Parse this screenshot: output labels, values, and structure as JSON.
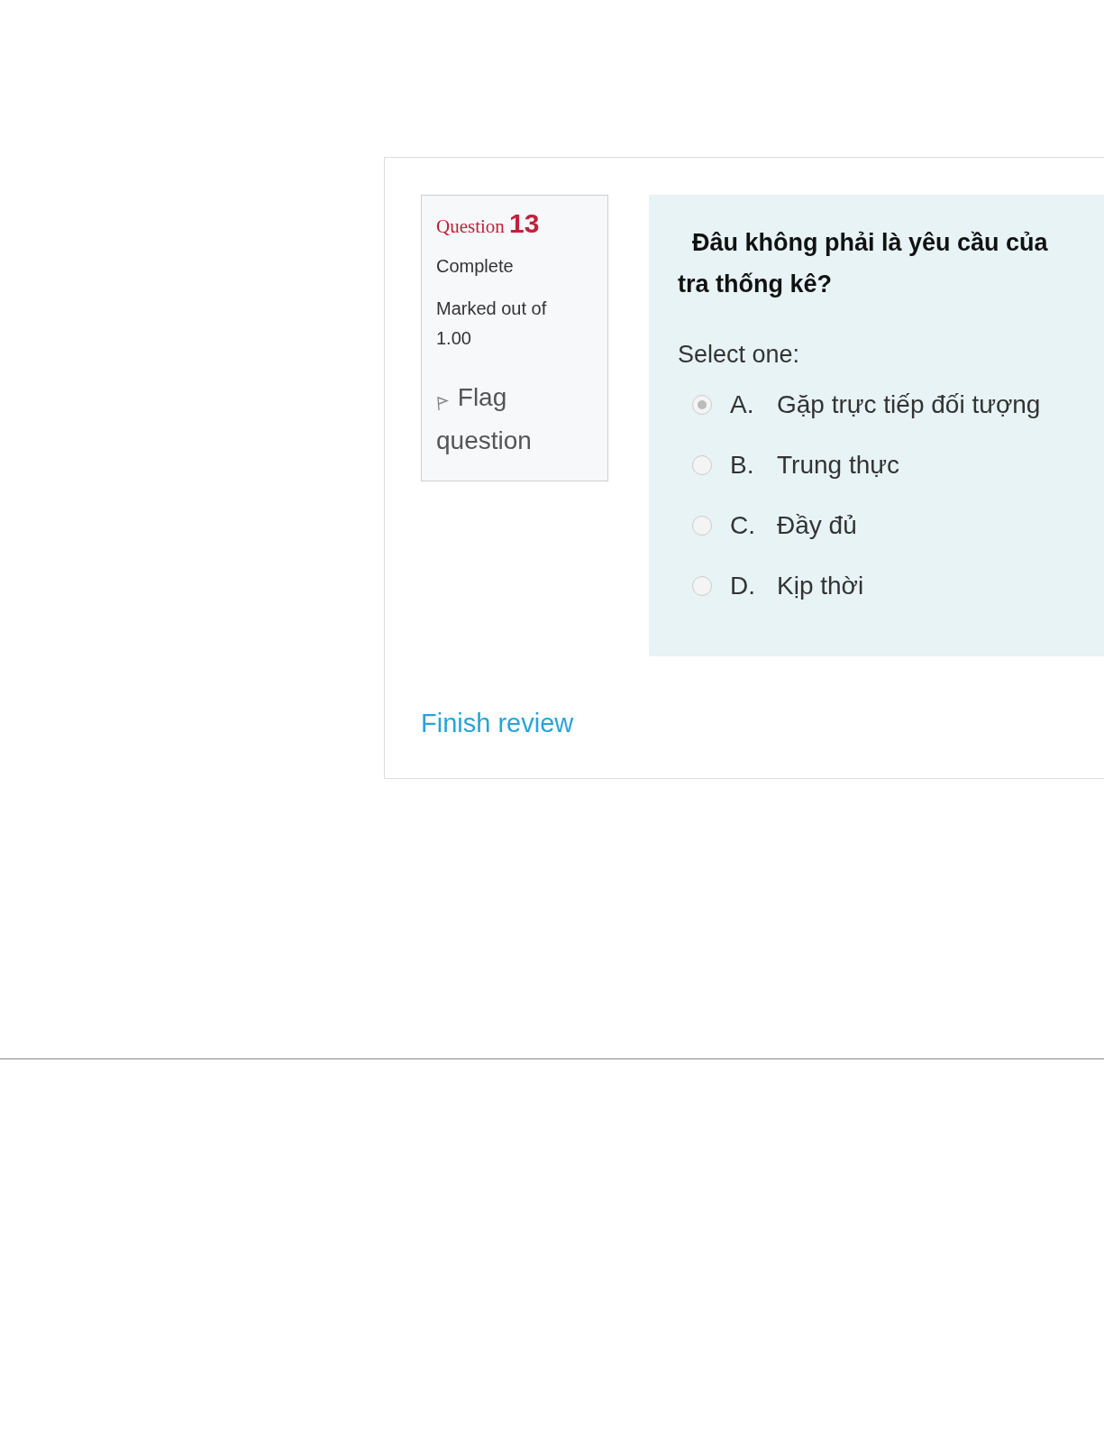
{
  "question_info": {
    "label": "Question",
    "number": "13",
    "state": "Complete",
    "mark_label": "Marked out of",
    "mark_value": "1.00",
    "flag": {
      "label": "Flag question",
      "flagged": false
    }
  },
  "question": {
    "text_lines": [
      "Đâu không phải là yêu cầu của",
      "tra thống kê?"
    ],
    "prompt": "Select one:",
    "options": [
      {
        "letter": "A.",
        "text": "Gặp trực tiếp đối tượng",
        "selected": true
      },
      {
        "letter": "B.",
        "text": "Trung thực",
        "selected": false
      },
      {
        "letter": "C.",
        "text": "Đầy đủ",
        "selected": false
      },
      {
        "letter": "D.",
        "text": "Kịp thời",
        "selected": false
      }
    ]
  },
  "finish_link": "Finish review"
}
